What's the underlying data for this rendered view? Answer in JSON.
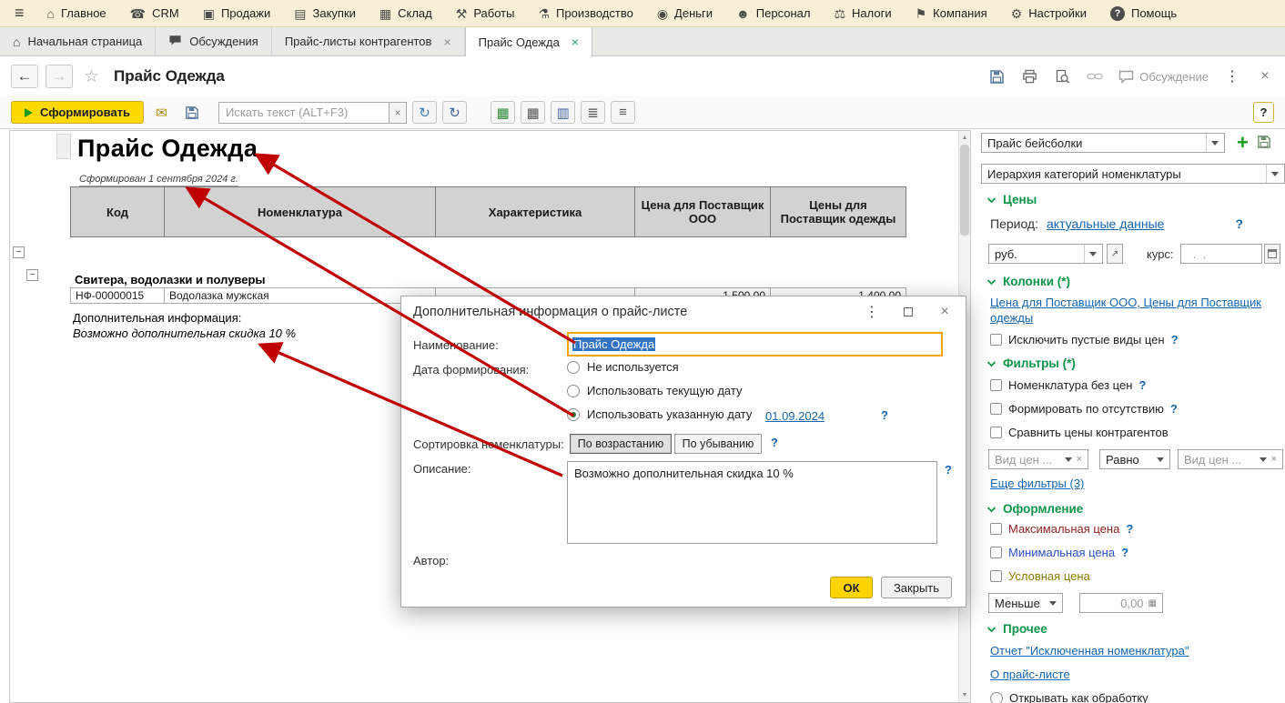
{
  "help_mark": "?",
  "icons": {
    "menu": "≡",
    "main": "⌂",
    "crm": "☎",
    "sales": "▣",
    "purchases": "▤",
    "warehouse": "▦",
    "works": "⚒",
    "production": "⚗",
    "money": "◉",
    "personnel": "☻",
    "taxes": "⚖",
    "company": "⚑",
    "settings": "⚙",
    "help": "?",
    "home": "⌂",
    "close": "×",
    "back": "←",
    "forward": "→",
    "star": "☆",
    "kebab": "⋮",
    "envelope": "✉",
    "refresh": "↻",
    "grid_color": "▦",
    "grid": "▦",
    "grid_cols": "▥",
    "list": "≣",
    "list_indent": "≡",
    "plus": "+",
    "minus": "−",
    "tri_up": "▲",
    "tri_down": "▼",
    "table_small": "▦"
  },
  "colors": {
    "accent_yellow": "#ffd900",
    "section_green": "#0d9448",
    "link_blue": "#1465b0",
    "arrow_red": "#c00000",
    "selection_blue": "#3173c6",
    "max_price": "#8e1f1f",
    "min_price": "#2b50c8",
    "conditional_price": "#8a7a00"
  },
  "menu": {
    "items": [
      "Главное",
      "CRM",
      "Продажи",
      "Закупки",
      "Склад",
      "Работы",
      "Производство",
      "Деньги",
      "Персонал",
      "Налоги",
      "Компания",
      "Настройки",
      "Помощь"
    ]
  },
  "tabs": [
    {
      "label": "Начальная страница"
    },
    {
      "label": "Обсуждения"
    },
    {
      "label": "Прайс-листы контрагентов"
    },
    {
      "label": "Прайс Одежда"
    }
  ],
  "titlebar": {
    "title": "Прайс Одежда",
    "discussion_label": "Обсуждение"
  },
  "commandbar": {
    "generate_label": "Сформировать",
    "search_placeholder": "Искать текст (ALT+F3)"
  },
  "report": {
    "title": "Прайс Одежда",
    "generated_caption": "Сформирован 1 сентября 2024 г.",
    "columns": [
      "Код",
      "Номенклатура",
      "Характеристика",
      "Цена для Поставщик ООО",
      "Цены для Поставщик одежды"
    ],
    "group_row": "Свитера, водолазки и полуверы",
    "rows": [
      {
        "code": "НФ-00000015",
        "item": "Водолазка мужская",
        "characteristic": "",
        "price1": "1 500,00",
        "price2": "1 400,00"
      }
    ],
    "footer_label": "Дополнительная информация:",
    "footer_note": "Возможно дополнительная скидка 10 %"
  },
  "dialog": {
    "title": "Дополнительная информация о прайс-листе",
    "name_label": "Наименование:",
    "name_value": "Прайс Одежда",
    "date_label": "Дата формирования:",
    "date_options": [
      {
        "label": "Не используется",
        "selected": false
      },
      {
        "label": "Использовать текущую дату",
        "selected": false
      },
      {
        "label": "Использовать указанную дату",
        "selected": true
      }
    ],
    "date_value": "01.09.2024",
    "sort_label": "Сортировка номенклатуры:",
    "sort_asc": "По возрастанию",
    "sort_desc": "По убыванию",
    "description_label": "Описание:",
    "description_value": "Возможно дополнительная скидка 10 %",
    "author_label": "Автор:",
    "ok_label": "ОК",
    "close_label": "Закрыть"
  },
  "panel": {
    "pricelist_value": "Прайс бейсболки",
    "hierarchy_value": "Иерархия категорий номенклатуры",
    "prices": {
      "title": "Цены",
      "period_label": "Период:",
      "period_value": "актуальные данные",
      "currency_value": "руб.",
      "rate_label": "курс:",
      "rate_value": "  .  ."
    },
    "columns": {
      "title": "Колонки (*)",
      "columns_link": "Цена для Поставщик ООО, Цены для Поставщик одежды",
      "exclude_empty_label": "Исключить пустые виды цен"
    },
    "filters": {
      "title": "Фильтры (*)",
      "no_prices_label": "Номенклатура без цен",
      "by_absence_label": "Формировать по отсутствию",
      "compare_label": "Сравнить цены контрагентов",
      "price_kind_placeholder": "Вид цен ...",
      "condition_value": "Равно",
      "more_filters_link": "Еще фильтры (3)"
    },
    "appearance": {
      "title": "Оформление",
      "max_label": "Максимальная цена",
      "min_label": "Минимальная цена",
      "conditional_label": "Условная цена",
      "less_value": "Меньше",
      "amount_value": "0,00"
    },
    "other": {
      "title": "Прочее",
      "excluded_report_link": "Отчет \"Исключенная номенклатура\"",
      "about_link": "О прайс-листе",
      "open_as_processing_label": "Открывать как обработку"
    }
  }
}
